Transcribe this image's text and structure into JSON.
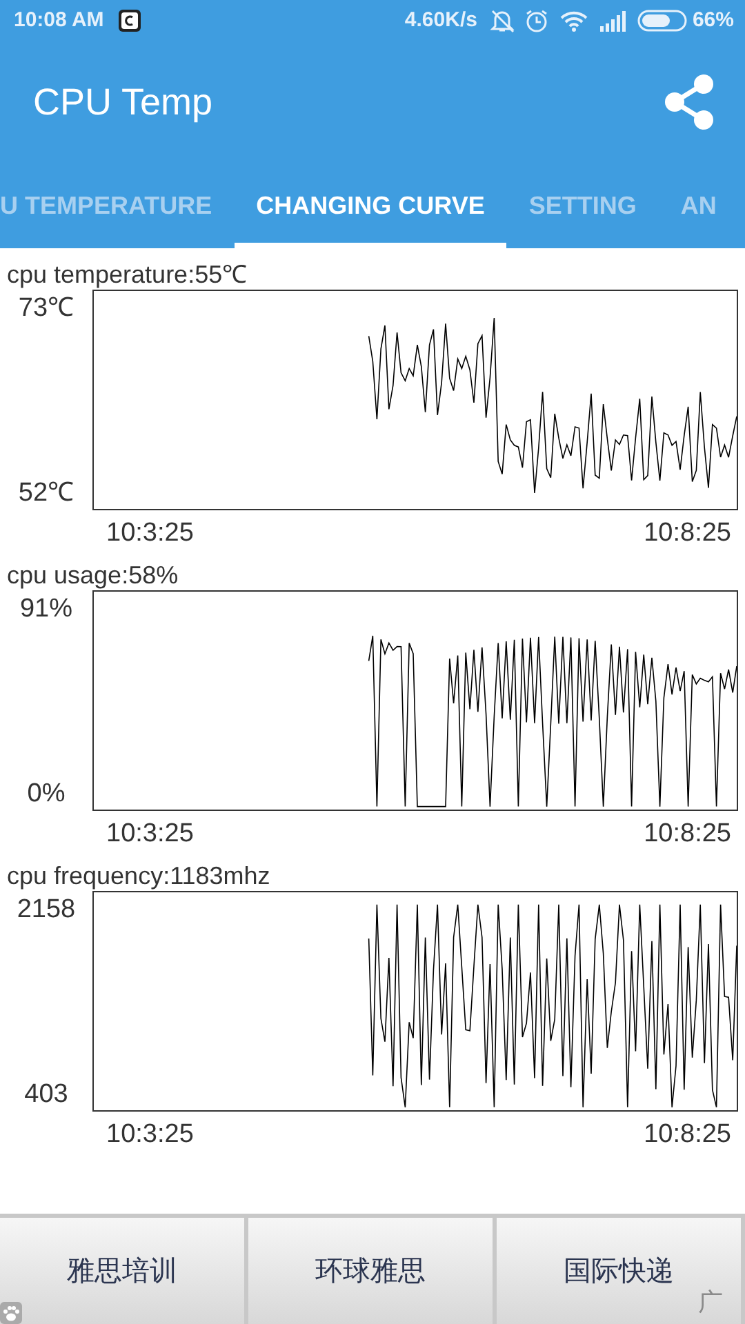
{
  "status_bar": {
    "time": "10:08 AM",
    "speed": "4.60K/s",
    "battery": "66%"
  },
  "app_bar": {
    "title": "CPU Temp"
  },
  "tabs": [
    {
      "label": "U TEMPERATURE",
      "selected": false
    },
    {
      "label": "CHANGING CURVE",
      "selected": true
    },
    {
      "label": "SETTING",
      "selected": false
    },
    {
      "label": "AN",
      "selected": false
    }
  ],
  "charts": [
    {
      "title": "cpu temperature:55℃",
      "y_max": "73℃",
      "y_min": "52℃",
      "x_start": "10:3:25",
      "x_end": "10:8:25"
    },
    {
      "title": "cpu usage:58%",
      "y_max": "91%",
      "y_min": "0%",
      "x_start": "10:3:25",
      "x_end": "10:8:25"
    },
    {
      "title": "cpu frequency:1183mhz",
      "y_max": "2158",
      "y_min": "403",
      "x_start": "10:3:25",
      "x_end": "10:8:25"
    }
  ],
  "ad_bar": {
    "buttons": [
      "雅思培训",
      "环球雅思",
      "国际快递"
    ],
    "ad_label": "广"
  }
}
